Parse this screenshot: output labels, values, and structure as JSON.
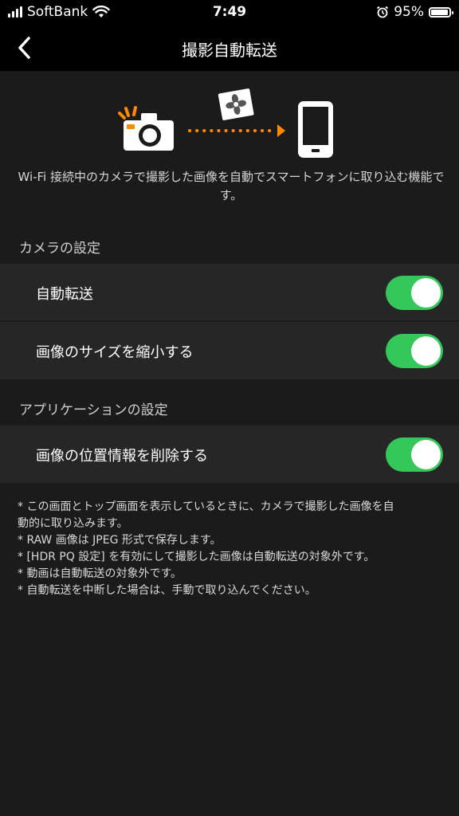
{
  "status_bar": {
    "carrier": "SoftBank",
    "time": "7:49",
    "battery": "95%"
  },
  "nav": {
    "title": "撮影自動転送"
  },
  "hero": {
    "description": "Wi-Fi 接続中のカメラで撮影した画像を自動でスマートフォンに取り込む機能です。"
  },
  "camera_section": {
    "header": "カメラの設定",
    "items": [
      {
        "label": "自動転送",
        "on": true
      },
      {
        "label": "画像のサイズを縮小する",
        "on": true
      }
    ]
  },
  "app_section": {
    "header": "アプリケーションの設定",
    "items": [
      {
        "label": "画像の位置情報を削除する",
        "on": true
      }
    ]
  },
  "notes": [
    "* この画面とトップ画面を表示しているときに、カメラで撮影した画像を自",
    "動的に取り込みます。",
    "* RAW 画像は JPEG 形式で保存します。",
    "* [HDR PQ 設定] を有効にして撮影した画像は自動転送の対象外です。",
    "* 動画は自動転送の対象外です。",
    "* 自動転送を中断した場合は、手動で取り込んでください。"
  ],
  "colors": {
    "accent_orange": "#ff8a00",
    "toggle_on": "#34c759"
  },
  "icons": [
    "wifi-icon",
    "alarm-icon",
    "back-chevron-icon",
    "camera-icon",
    "flower-photo-icon",
    "smartphone-icon"
  ]
}
